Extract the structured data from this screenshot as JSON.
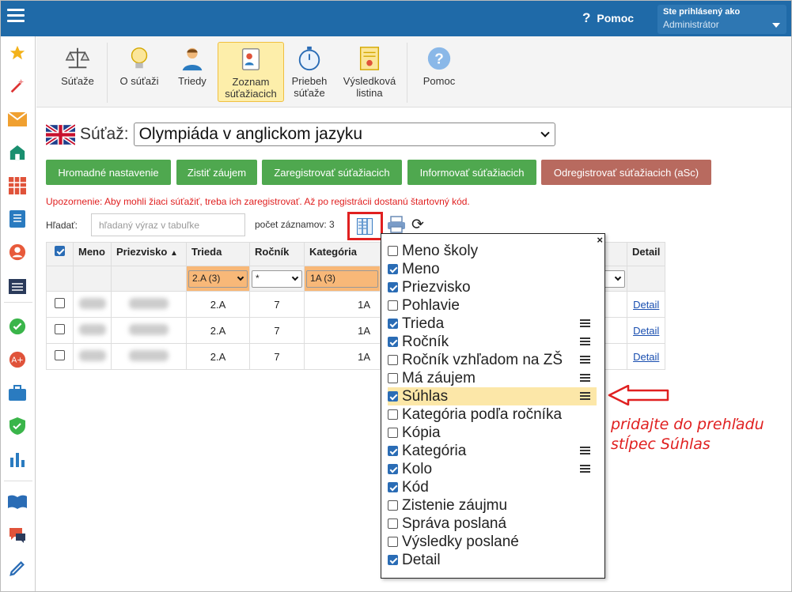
{
  "header": {
    "help": "Pomoc",
    "user_line1": "Ste prihlásený ako",
    "user_line2": "Administrátor"
  },
  "toolbar": [
    {
      "label": "Súťaže"
    },
    {
      "label": "O súťaži"
    },
    {
      "label": "Triedy"
    },
    {
      "label": "Zoznam súťažiacich"
    },
    {
      "label": "Priebeh súťaže"
    },
    {
      "label": "Výsledková listina"
    },
    {
      "label": "Pomoc"
    }
  ],
  "contest": {
    "label": "Súťaž:",
    "value": "Olympiáda v anglickom jazyku"
  },
  "buttons": [
    "Hromadné nastavenie",
    "Zistiť záujem",
    "Zaregistrovať súťažiacich",
    "Informovať súťažiacich",
    "Odregistrovať súťažiacich (aSc)"
  ],
  "warning": "Upozornenie: Aby mohli žiaci súťažiť, treba ich zaregistrovať. Až po registrácii dostanú štartovný kód.",
  "search": {
    "label": "Hľadať:",
    "placeholder": "hľadaný výraz v tabuľke"
  },
  "count": "počet záznamov: 3",
  "table": {
    "headers": [
      "Meno",
      "Priezvisko",
      "Trieda",
      "Ročník",
      "Kategória",
      "Detail"
    ],
    "sort_indicator": "▲",
    "filters": {
      "trieda": "2.A (3)",
      "rocnik": "*",
      "kategoria": "1A (3)"
    },
    "rows": [
      {
        "trieda": "2.A",
        "rocnik": "7",
        "kategoria": "1A",
        "detail": "Detail"
      },
      {
        "trieda": "2.A",
        "rocnik": "7",
        "kategoria": "1A",
        "detail": "Detail"
      },
      {
        "trieda": "2.A",
        "rocnik": "7",
        "kategoria": "1A",
        "detail": "Detail"
      }
    ]
  },
  "columns_popup": {
    "close": "×",
    "items": [
      {
        "label": "Meno školy",
        "checked": false,
        "sortable": false
      },
      {
        "label": "Meno",
        "checked": true,
        "sortable": false
      },
      {
        "label": "Priezvisko",
        "checked": true,
        "sortable": false
      },
      {
        "label": "Pohlavie",
        "checked": false,
        "sortable": false
      },
      {
        "label": "Trieda",
        "checked": true,
        "sortable": true
      },
      {
        "label": "Ročník",
        "checked": true,
        "sortable": true
      },
      {
        "label": "Ročník vzhľadom na ZŠ",
        "checked": false,
        "sortable": true
      },
      {
        "label": "Má záujem",
        "checked": false,
        "sortable": true
      },
      {
        "label": "Súhlas",
        "checked": true,
        "sortable": true,
        "highlighted": true
      },
      {
        "label": "Kategória podľa ročníka",
        "checked": false,
        "sortable": false
      },
      {
        "label": "Kópia",
        "checked": false,
        "sortable": false
      },
      {
        "label": "Kategória",
        "checked": true,
        "sortable": true
      },
      {
        "label": "Kolo",
        "checked": true,
        "sortable": true
      },
      {
        "label": "Kód",
        "checked": true,
        "sortable": false
      },
      {
        "label": "Zistenie záujmu",
        "checked": false,
        "sortable": false
      },
      {
        "label": "Správa poslaná",
        "checked": false,
        "sortable": false
      },
      {
        "label": "Výsledky poslané",
        "checked": false,
        "sortable": false
      },
      {
        "label": "Detail",
        "checked": true,
        "sortable": false
      }
    ]
  },
  "annotation": {
    "line1": "pridajte do prehľadu",
    "line2": "stĺpec Súhlas"
  },
  "colors": {
    "topbar": "#1f6aa8",
    "green": "#4fa84f",
    "red_button": "#b86a5f",
    "warning": "#e02020",
    "highlight": "#fce7a8"
  }
}
